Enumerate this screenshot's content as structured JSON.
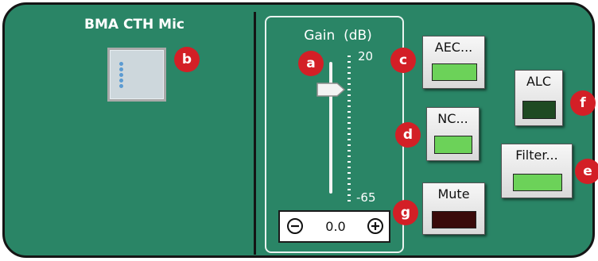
{
  "device": {
    "name": "BMA CTH Mic",
    "icon": "microphone-device-icon"
  },
  "gain": {
    "label": "Gain  (dB)",
    "max_label": "20",
    "min_label": "-65",
    "value": "0.0",
    "decrement_icon": "minus-circle-icon",
    "increment_icon": "plus-circle-icon"
  },
  "buttons": {
    "aec": {
      "label": "AEC...",
      "indicator_color": "#6cd259"
    },
    "nc": {
      "label": "NC...",
      "indicator_color": "#6cd259"
    },
    "mute": {
      "label": "Mute",
      "indicator_color": "#3a0a0a"
    },
    "alc": {
      "label": "ALC",
      "indicator_color": "#1e4a22"
    },
    "filter": {
      "label": "Filter...",
      "indicator_color": "#6cd259"
    }
  },
  "badges": {
    "a": "a",
    "b": "b",
    "c": "c",
    "d": "d",
    "e": "e",
    "f": "f",
    "g": "g"
  },
  "colors": {
    "panel": "#2a8566",
    "badge": "#d31f26"
  }
}
